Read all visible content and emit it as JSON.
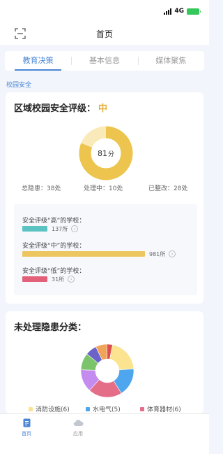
{
  "status_bar": {
    "network": "4G"
  },
  "nav": {
    "title": "首页",
    "scan_icon": "scan-icon"
  },
  "tabs": [
    {
      "label": "教育决策",
      "active": true
    },
    {
      "label": "基本信息",
      "active": false
    },
    {
      "label": "媒体聚焦",
      "active": false
    }
  ],
  "section_label": "校园安全",
  "safety_card": {
    "title": "区域校园安全评级：",
    "level": "中",
    "score": "81",
    "score_unit": "分",
    "score_value": 81,
    "score_max": 100,
    "stats": {
      "total": "总隐患：38处",
      "processing": "处理中：10处",
      "fixed": "已整改：28处"
    },
    "ratings": [
      {
        "label": "安全评级“高”的学校：",
        "count": "137所",
        "value": 137,
        "color": "#5cc3c3"
      },
      {
        "label": "安全评级“中”的学校：",
        "count": "981所",
        "value": 981,
        "color": "#edc661"
      },
      {
        "label": "安全评级“低”的学校：",
        "count": "31所",
        "value": 31,
        "color": "#e2607a"
      }
    ],
    "colors": {
      "accent": "#e6b13c",
      "donut_light": "#fbeab9"
    }
  },
  "hazard_card": {
    "title": "未处理隐患分类：",
    "legend": [
      {
        "label": "消防设施(6)",
        "color": "#fbe38f"
      },
      {
        "label": "水电气(5)",
        "color": "#4da6ee"
      },
      {
        "label": "体育器材(6)",
        "color": "#e46d88"
      }
    ]
  },
  "chart_data": {
    "type": "pie",
    "labels": [
      "消防设施",
      "水电气",
      "体育器材",
      "",
      "",
      "",
      "",
      ""
    ],
    "values": [
      6,
      5,
      6,
      4,
      3,
      2,
      2,
      1
    ],
    "colors": [
      "#fbe38f",
      "#4da6ee",
      "#e46d88",
      "#c58cf0",
      "#7cc46b",
      "#6b63c8",
      "#f0a45a",
      "#dc4f4f"
    ]
  },
  "tabbar": [
    {
      "label": "首页",
      "icon": "doc-icon",
      "active": true
    },
    {
      "label": "应用",
      "icon": "cloud-icon",
      "active": false
    }
  ]
}
